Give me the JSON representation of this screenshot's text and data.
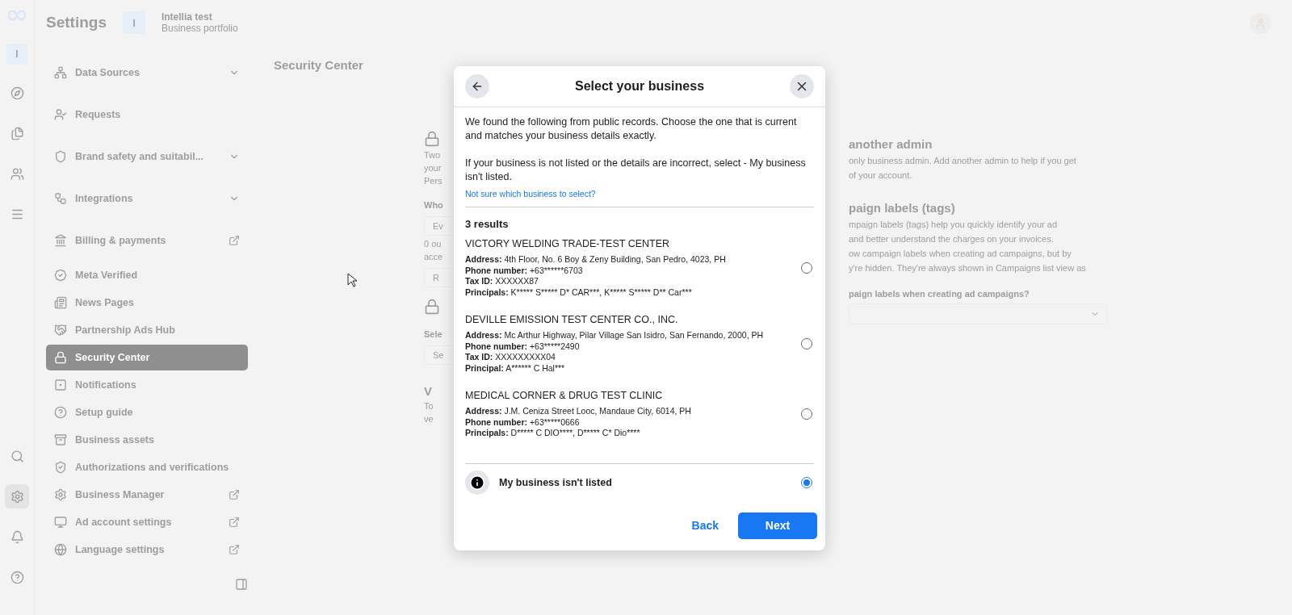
{
  "rail": {
    "items": [
      {
        "kind": "logo",
        "selected": false
      },
      {
        "kind": "avatar",
        "label": "I",
        "selected": false
      },
      {
        "kind": "compass",
        "selected": false
      },
      {
        "kind": "pages",
        "selected": false
      },
      {
        "kind": "people",
        "selected": false
      },
      {
        "kind": "menu",
        "selected": false
      }
    ],
    "bottom": [
      {
        "kind": "search",
        "selected": false
      },
      {
        "kind": "settings",
        "selected": true
      },
      {
        "kind": "bell",
        "selected": false
      },
      {
        "kind": "help",
        "selected": false
      }
    ]
  },
  "header": {
    "title": "Settings",
    "initial": "I",
    "name": "Intellia test",
    "type": "Business portfolio"
  },
  "sidebar": {
    "items": [
      {
        "label": "Data Sources",
        "kind": "expandable",
        "selected": false
      },
      {
        "label": "Requests",
        "kind": "plain",
        "selected": false
      },
      {
        "label": "Brand safety and suitabil...",
        "kind": "expandable",
        "selected": false
      },
      {
        "label": "Integrations",
        "kind": "expandable",
        "selected": false
      },
      {
        "label": "Billing & payments",
        "kind": "external",
        "selected": false
      },
      {
        "label": "Meta Verified",
        "kind": "plain",
        "selected": false
      },
      {
        "label": "News Pages",
        "kind": "plain",
        "selected": false
      },
      {
        "label": "Partnership Ads Hub",
        "kind": "plain",
        "selected": false
      },
      {
        "label": "Security Center",
        "kind": "plain",
        "selected": true
      },
      {
        "label": "Notifications",
        "kind": "plain",
        "selected": false
      },
      {
        "label": "Setup guide",
        "kind": "plain",
        "selected": false
      },
      {
        "label": "Business assets",
        "kind": "plain",
        "selected": false
      },
      {
        "label": "Authorizations and verifications",
        "kind": "plain",
        "selected": false
      },
      {
        "label": "Business Manager",
        "kind": "external",
        "selected": false
      },
      {
        "label": "Ad account settings",
        "kind": "external",
        "selected": false
      },
      {
        "label": "Language settings",
        "kind": "external",
        "selected": false
      }
    ]
  },
  "page": {
    "title": "Security Center",
    "left_fragments": [
      {
        "kind": "icon"
      },
      {
        "kind": "text",
        "text": "Two"
      },
      {
        "kind": "text",
        "text": "your"
      },
      {
        "kind": "text",
        "text": "Pers"
      },
      {
        "kind": "label",
        "text": "Who"
      },
      {
        "kind": "field",
        "text": "Ev"
      },
      {
        "kind": "text",
        "text": "0 ou"
      },
      {
        "kind": "text",
        "text": "acce"
      },
      {
        "kind": "field",
        "text": "R"
      },
      {
        "kind": "icon"
      },
      {
        "kind": "label",
        "text": "Sele"
      },
      {
        "kind": "field",
        "text": "Se"
      },
      {
        "kind": "heading",
        "text": "V"
      },
      {
        "kind": "text",
        "text": "To"
      },
      {
        "kind": "text",
        "text": "ve"
      }
    ],
    "right_fragments": [
      {
        "kind": "heading",
        "text": "another admin"
      },
      {
        "kind": "text",
        "text": "only business admin. Add another admin to help if you get"
      },
      {
        "kind": "text",
        "text": "of your account."
      },
      {
        "kind": "heading",
        "text": "paign labels (tags)"
      },
      {
        "kind": "text",
        "text": "mpaign labels (tags) help you quickly identify your ad"
      },
      {
        "kind": "text",
        "text": "and better understand the charges on your invoices."
      },
      {
        "kind": "text",
        "text": "ow campaign labels when creating ad campaigns, but by"
      },
      {
        "kind": "text",
        "text": "y're hidden. They're always shown in Campaigns list view as"
      },
      {
        "kind": "label",
        "text": "paign labels when creating ad campaigns?"
      },
      {
        "kind": "select"
      }
    ]
  },
  "dialog": {
    "title": "Select your business",
    "intro": "We found the following from public records. Choose the one that is current and matches your business details exactly.",
    "note": "If your business is not listed or the details are incorrect, select - My business isn't listed.",
    "help_link": "Not sure which business to select?",
    "results_count": "3 results",
    "results": [
      {
        "name": "VICTORY WELDING TRADE-TEST CENTER",
        "lines": [
          {
            "label": "Address:",
            "value": "4th Floor, No. 6 Boy & Zeny Building, San Pedro, 4023, PH"
          },
          {
            "label": "Phone number:",
            "value": "+63******6703"
          },
          {
            "label": "Tax ID:",
            "value": "XXXXXX87"
          },
          {
            "label": "Principals:",
            "value": "K***** S***** D* CAR***, K***** S***** D** Car***"
          }
        ],
        "selected": false
      },
      {
        "name": "DEVILLE EMISSION TEST CENTER CO., INC.",
        "lines": [
          {
            "label": "Address:",
            "value": "Mc Arthur Highway, Pilar Village San Isidro, San Fernando, 2000, PH"
          },
          {
            "label": "Phone number:",
            "value": "+63*****2490"
          },
          {
            "label": "Tax ID:",
            "value": "XXXXXXXXX04"
          },
          {
            "label": "Principal:",
            "value": "A****** C Hal***"
          }
        ],
        "selected": false
      },
      {
        "name": "MEDICAL CORNER & DRUG TEST CLINIC",
        "lines": [
          {
            "label": "Address:",
            "value": "J.M. Ceniza Street Looc, Mandaue City, 6014, PH"
          },
          {
            "label": "Phone number:",
            "value": "+63*****0666"
          },
          {
            "label": "Principals:",
            "value": "D***** C DIO****, D***** C* Dio****"
          }
        ],
        "selected": false
      }
    ],
    "fallback": {
      "label": "My business isn't listed",
      "selected": true
    },
    "back": "Back",
    "next": "Next"
  }
}
